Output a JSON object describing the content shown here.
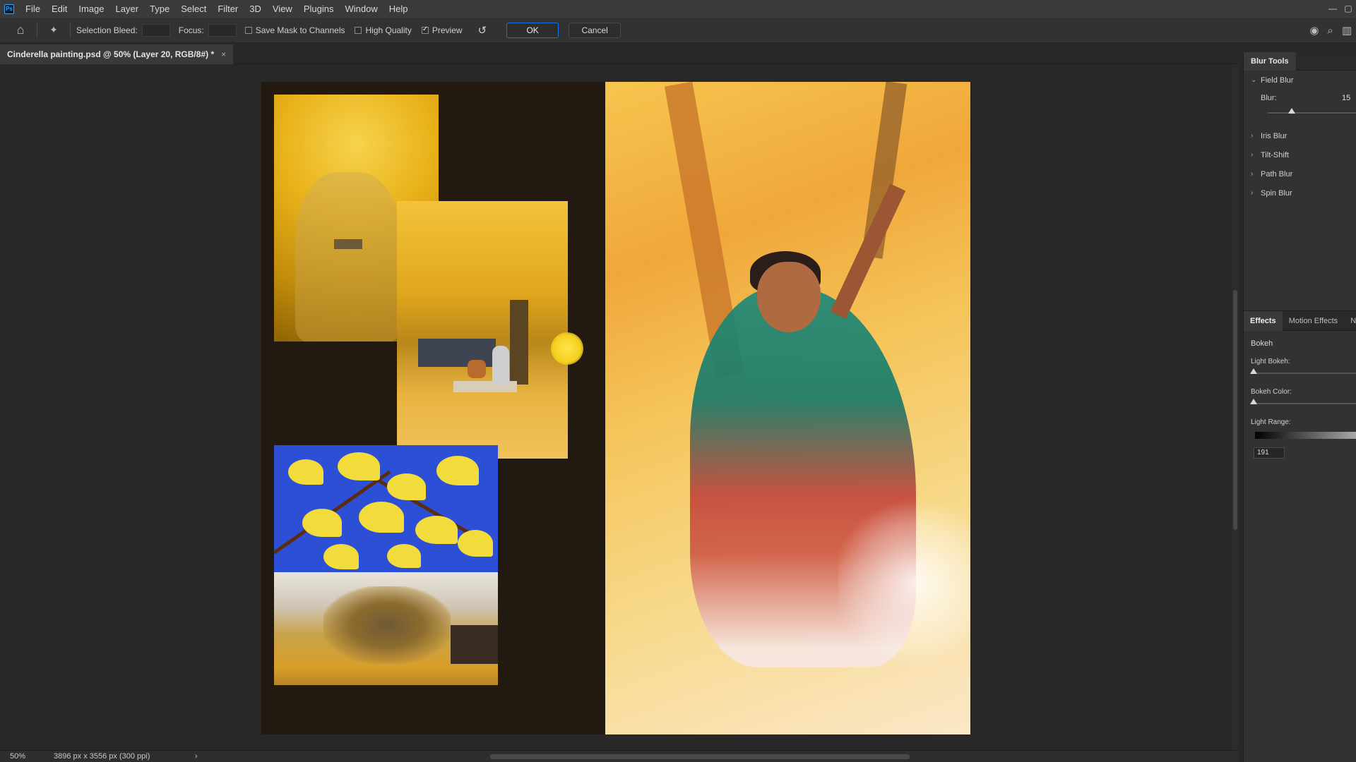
{
  "app": {
    "logo_text": "Ps"
  },
  "menu": [
    "File",
    "Edit",
    "Image",
    "Layer",
    "Type",
    "Select",
    "Filter",
    "3D",
    "View",
    "Plugins",
    "Window",
    "Help"
  ],
  "options": {
    "selection_bleed_label": "Selection Bleed:",
    "focus_label": "Focus:",
    "save_mask_label": "Save Mask to Channels",
    "save_mask_checked": false,
    "high_quality_label": "High Quality",
    "high_quality_checked": false,
    "preview_label": "Preview",
    "preview_checked": true,
    "ok_label": "OK",
    "cancel_label": "Cancel"
  },
  "document": {
    "tab_title": "Cinderella painting.psd @ 50% (Layer 20, RGB/8#) *",
    "close_glyph": "×"
  },
  "status": {
    "zoom": "50%",
    "doc_size": "3896 px x 3556 px (300 ppi)",
    "arrow": "›"
  },
  "blur_panel": {
    "title": "Blur Tools",
    "field_blur": {
      "label": "Field Blur",
      "expanded": true,
      "blur_label": "Blur:",
      "blur_value": "15"
    },
    "items": [
      "Iris Blur",
      "Tilt-Shift",
      "Path Blur",
      "Spin Blur"
    ]
  },
  "effects_panel": {
    "tabs": [
      "Effects",
      "Motion Effects",
      "No"
    ],
    "section": "Bokeh",
    "light_bokeh_label": "Light Bokeh:",
    "bokeh_color_label": "Bokeh Color:",
    "light_range_label": "Light Range:",
    "light_range_value": "191"
  },
  "colors": {
    "accent_blue": "#1473e6",
    "panel_bg": "#323232",
    "canvas_bg": "#282828"
  }
}
